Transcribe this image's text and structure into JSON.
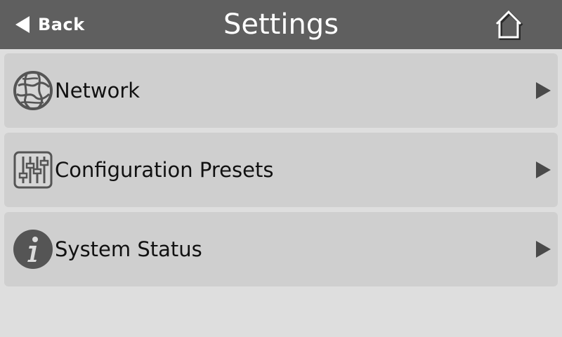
{
  "header": {
    "back_label": "Back",
    "title": "Settings",
    "home_icon": "home-icon"
  },
  "menu": {
    "items": [
      {
        "label": "Network",
        "icon": "globe-icon"
      },
      {
        "label": "Configuration Presets",
        "icon": "sliders-icon"
      },
      {
        "label": "System Status",
        "icon": "info-icon"
      }
    ]
  },
  "colors": {
    "header_bg": "#5f5f5f",
    "page_bg": "#dedede",
    "item_bg": "#cfcfcf",
    "icon_color": "#555555"
  }
}
